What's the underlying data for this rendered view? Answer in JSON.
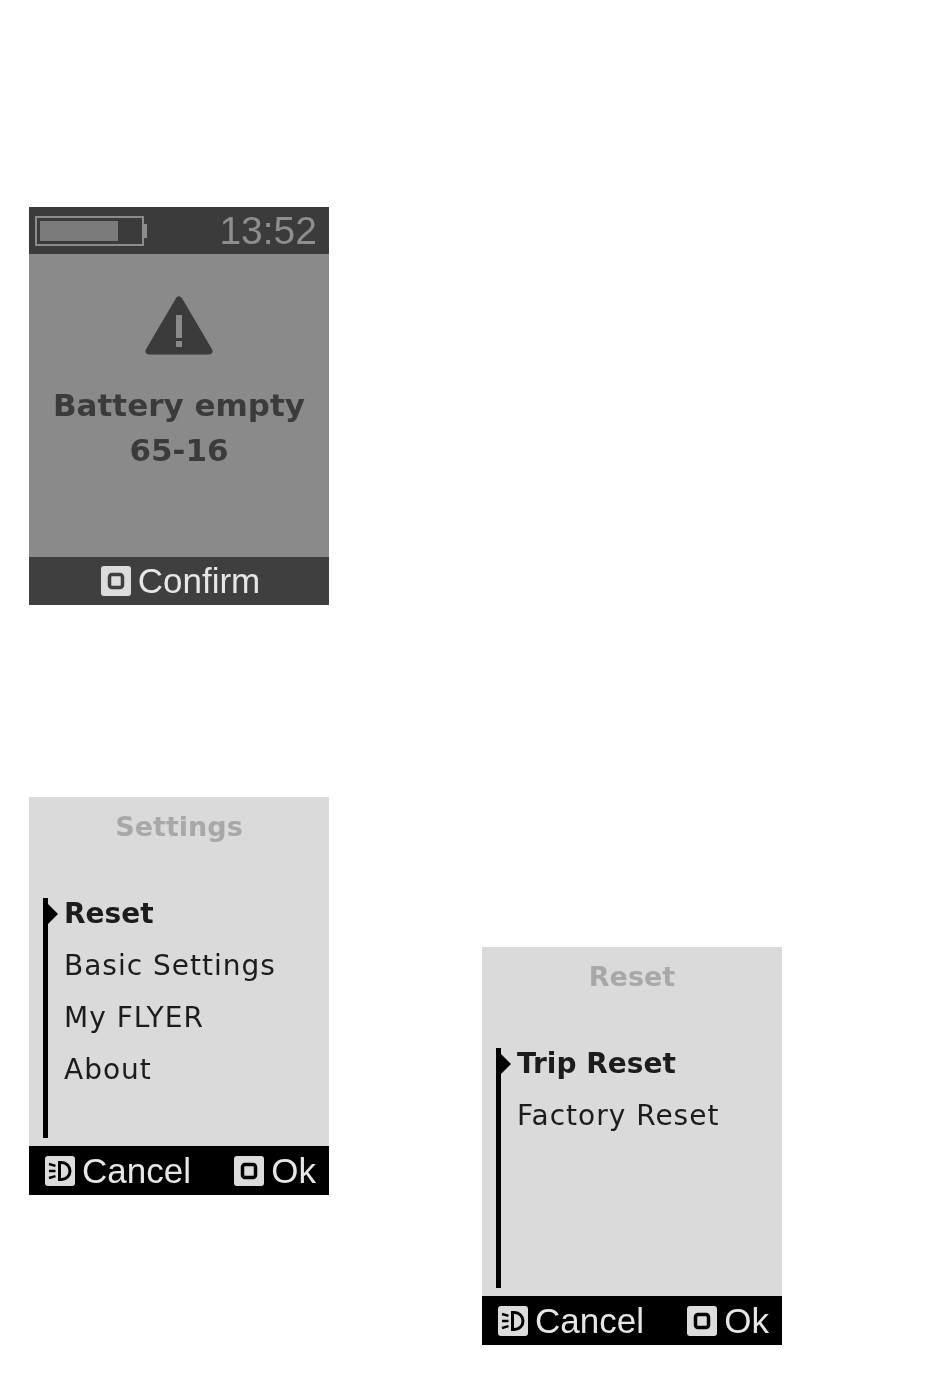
{
  "screens": [
    {
      "kind": "alert",
      "status_bar": {
        "time": "13:52"
      },
      "message": "Battery empty",
      "code": "65-16",
      "keys": [
        {
          "kind": "select",
          "label": "Confirm"
        }
      ]
    },
    {
      "kind": "menu",
      "title": "Settings",
      "items": [
        {
          "label": "Reset",
          "selected": true
        },
        {
          "label": "Basic Settings",
          "selected": false
        },
        {
          "label": "My FLYER",
          "selected": false
        },
        {
          "label": "About",
          "selected": false
        }
      ],
      "keys": [
        {
          "kind": "light",
          "label": "Cancel"
        },
        {
          "kind": "select",
          "label": "Ok"
        }
      ]
    },
    {
      "kind": "menu",
      "title": "Reset",
      "items": [
        {
          "label": "Trip Reset",
          "selected": true
        },
        {
          "label": "Factory Reset",
          "selected": false
        }
      ],
      "keys": [
        {
          "kind": "light",
          "label": "Cancel"
        },
        {
          "kind": "select",
          "label": "Ok"
        }
      ]
    }
  ]
}
